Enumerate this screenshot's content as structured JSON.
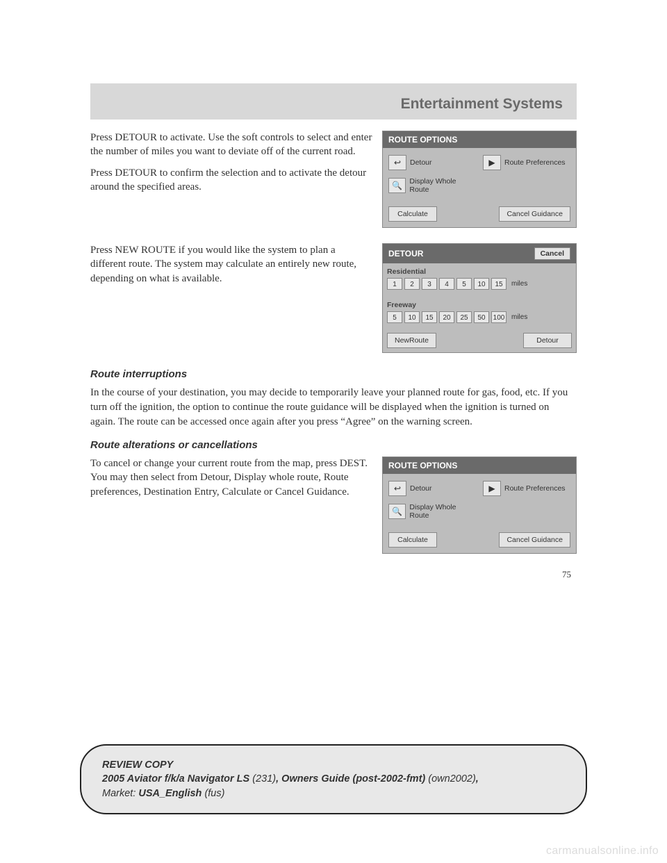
{
  "header": {
    "title": "Entertainment Systems"
  },
  "section1": {
    "p1": "Press DETOUR to activate. Use the soft controls to select and enter the number of miles you want to deviate off of the current road.",
    "p2": "Press DETOUR to confirm the selection and to activate the detour around the specified areas."
  },
  "panel1": {
    "title": "ROUTE OPTIONS",
    "options": {
      "detour": "Detour",
      "prefs": "Route Preferences",
      "display": "Display Whole Route"
    },
    "calculate": "Calculate",
    "cancel": "Cancel Guidance"
  },
  "section2": {
    "p1": "Press NEW ROUTE if you would like the system to plan a different route. The system may calculate an entirely new route, depending on what is available."
  },
  "panel2": {
    "title": "DETOUR",
    "cancel": "Cancel",
    "residential": "Residential",
    "freeway": "Freeway",
    "res_vals": [
      "1",
      "2",
      "3",
      "4",
      "5",
      "10",
      "15"
    ],
    "fwy_vals": [
      "5",
      "10",
      "15",
      "20",
      "25",
      "50",
      "100"
    ],
    "miles": "miles",
    "newroute": "NewRoute",
    "detour": "Detour"
  },
  "heading1": "Route interruptions",
  "para1": "In the course of your destination, you may decide to temporarily leave your planned route for gas, food, etc. If you turn off the ignition, the option to continue the route guidance will be displayed when the ignition is turned on again. The route can be accessed once again after you press “Agree” on the warning screen.",
  "heading2": "Route alterations or cancellations",
  "section3": {
    "p1": "To cancel or change your current route from the map, press DEST. You may then select from Detour, Display whole route, Route preferences, Destination Entry, Calculate or Cancel Guidance."
  },
  "page_number": "75",
  "footer": {
    "line1": "REVIEW COPY",
    "model": "2005 Aviator f/k/a Navigator LS",
    "code": "(231)",
    "guide": "Owners Guide (post-2002-fmt)",
    "own": "(own2002)",
    "market_label": "Market:",
    "market": "USA_English",
    "fus": "(fus)"
  },
  "watermark": "carmanualsonline.info"
}
